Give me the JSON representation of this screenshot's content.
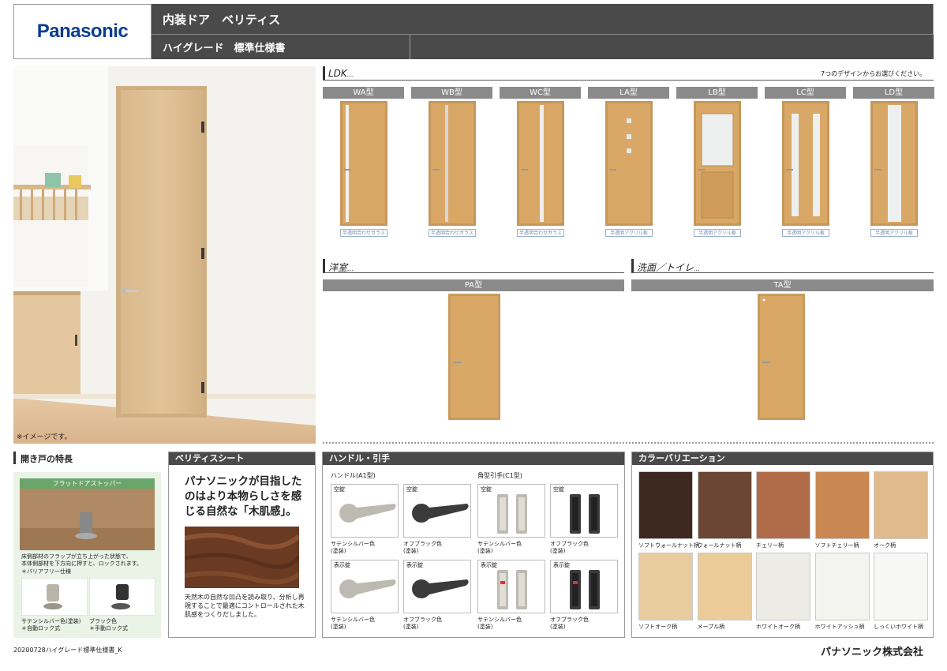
{
  "header": {
    "logo": "Panasonic",
    "title": "内装ドア　ベリティス",
    "subtitle": "ハイグレード　標準仕様書"
  },
  "room_photo": {
    "caption": "※イメージです。"
  },
  "ldk": {
    "title": "LDK",
    "note": "7つのデザインからお選びください。",
    "doors": [
      {
        "label": "WA型",
        "glass": "半透明合わせガラス"
      },
      {
        "label": "WB型",
        "glass": "半透明合わせガラス"
      },
      {
        "label": "WC型",
        "glass": "半透明合わせガラス"
      },
      {
        "label": "LA型",
        "glass": "半透明アクリル板"
      },
      {
        "label": "LB型",
        "glass": "半透明アクリル板"
      },
      {
        "label": "LC型",
        "glass": "半透明アクリル板"
      },
      {
        "label": "LD型",
        "glass": "半透明アクリル板"
      }
    ]
  },
  "western": {
    "title": "洋室",
    "door": "PA型"
  },
  "washroom": {
    "title": "洗面／トイレ",
    "door": "TA型"
  },
  "features": {
    "title": "開き戸の特長",
    "stopper_title": "フラットドアストッパー",
    "desc1": "床側部材のフラップが立ち上がった状態で、",
    "desc2": "本体側部材を下方向に押すと、ロックされます。",
    "desc3": "＊バリアフリー仕様",
    "opt1_line1": "サテンシルバー色(塗装)",
    "opt1_line2": "＊自動ロック式",
    "opt2_line1": "ブラック色",
    "opt2_line2": "＊手動ロック式"
  },
  "sheet": {
    "title": "ベリティスシート",
    "headline": "パナソニックが目指したのはより本物らしさを感じる自然な「木肌感」。",
    "body": "天然木の自然な凹凸を読み取り、分析し再現することで最適にコントロールされた木肌感をつくりだしました。"
  },
  "handles": {
    "title": "ハンドル・引手",
    "lever_title": "ハンドル(A1型)",
    "pull_title": "角型引手(C1型)",
    "cards": [
      {
        "lock": "空錠",
        "name": "サテンシルバー色",
        "finish": "(塗装)"
      },
      {
        "lock": "空錠",
        "name": "オフブラック色",
        "finish": "(塗装)"
      },
      {
        "lock": "空錠",
        "name": "サテンシルバー色",
        "finish": "(塗装)"
      },
      {
        "lock": "空錠",
        "name": "オフブラック色",
        "finish": "(塗装)"
      },
      {
        "lock": "表示錠",
        "name": "サテンシルバー色",
        "finish": "(塗装)"
      },
      {
        "lock": "表示錠",
        "name": "オフブラック色",
        "finish": "(塗装)"
      },
      {
        "lock": "表示錠",
        "name": "サテンシルバー色",
        "finish": "(塗装)"
      },
      {
        "lock": "表示錠",
        "name": "オフブラック色",
        "finish": "(塗装)"
      }
    ]
  },
  "colors": {
    "title": "カラーバリエーション",
    "swatches": [
      {
        "name": "ソフトウォールナット柄",
        "hex": "#3f2820"
      },
      {
        "name": "ウォールナット柄",
        "hex": "#6b4634"
      },
      {
        "name": "チェリー柄",
        "hex": "#b06c48"
      },
      {
        "name": "ソフトチェリー柄",
        "hex": "#c98852"
      },
      {
        "name": "オーク柄",
        "hex": "#e0ba8a"
      },
      {
        "name": "ソフトオーク柄",
        "hex": "#e9cba0"
      },
      {
        "name": "メープル柄",
        "hex": "#ebcc98"
      },
      {
        "name": "ホワイトオーク柄",
        "hex": "#ecebe6"
      },
      {
        "name": "ホワイトアッシュ柄",
        "hex": "#f3f3f0"
      },
      {
        "name": "しっくいホワイト柄",
        "hex": "#f7f7f5"
      }
    ]
  },
  "footer": {
    "doc_id": "20200728ハイグレード標準仕様書_K",
    "company": "パナソニック株式会社"
  }
}
